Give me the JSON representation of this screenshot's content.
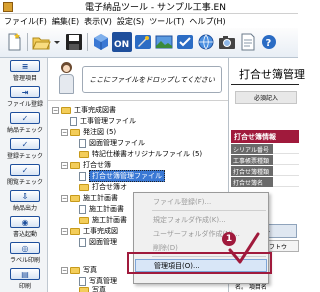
{
  "window": {
    "title": "電子納品ツール - サンプル工事.EN"
  },
  "menu": [
    "ファイル(F)",
    "編集(E)",
    "表示(V)",
    "設定(S)",
    "ツール(T)",
    "ヘルプ(H)"
  ],
  "colors": {
    "accent": "#a01a3c",
    "selection": "#3a78d4",
    "folder": "#f3cd5a",
    "toolbar_blue": "#1e4f9c"
  },
  "left_toolbar": [
    {
      "label": "管理項目",
      "icon": "document-list-icon"
    },
    {
      "label": "ファイル登録",
      "icon": "file-register-icon"
    },
    {
      "label": "納品チェック",
      "icon": "check-icon"
    },
    {
      "label": "登録チェック",
      "icon": "register-check-icon"
    },
    {
      "label": "閲覧チェック",
      "icon": "view-check-icon"
    },
    {
      "label": "納品出力",
      "icon": "output-icon"
    },
    {
      "label": "書込起動",
      "icon": "write-icon"
    },
    {
      "label": "ラベル印刷",
      "icon": "label-print-icon"
    },
    {
      "label": "印刷",
      "icon": "print-icon"
    }
  ],
  "drop_area": {
    "text": "ここにファイルをドロップしてください"
  },
  "tree": [
    {
      "label": "工事完成図書",
      "level": 0,
      "type": "folder"
    },
    {
      "label": "工事管理ファイル",
      "level": 1,
      "type": "file"
    },
    {
      "label": "発注図 (5)",
      "level": 1,
      "type": "folder"
    },
    {
      "label": "図面管理ファイル",
      "level": 2,
      "type": "file"
    },
    {
      "label": "特記仕様書オリジナルファイル (5)",
      "level": 2,
      "type": "folder"
    },
    {
      "label": "打合せ簿",
      "level": 1,
      "type": "folder"
    },
    {
      "label": "打合せ簿管理ファイル",
      "level": 2,
      "type": "file",
      "selected": true
    },
    {
      "label": "打合せ簿オ",
      "level": 2,
      "type": "folder"
    },
    {
      "label": "施工計画書",
      "level": 1,
      "type": "folder"
    },
    {
      "label": "施工計画書",
      "level": 2,
      "type": "file"
    },
    {
      "label": "施工計画書",
      "level": 2,
      "type": "folder"
    },
    {
      "label": "工事完成図",
      "level": 1,
      "type": "folder"
    },
    {
      "label": "図面管理",
      "level": 2,
      "type": "file"
    },
    {
      "label": "写真",
      "level": 1,
      "type": "folder"
    },
    {
      "label": "写真管理",
      "level": 2,
      "type": "file"
    },
    {
      "label": "写真",
      "level": 2,
      "type": "folder"
    }
  ],
  "context_menu": [
    {
      "label": "ファイル登録(F)...",
      "disabled": true
    },
    {
      "label": "---"
    },
    {
      "label": "規定フォルダ作成(K)...",
      "disabled": true
    },
    {
      "label": "ユーザーフォルダ作成(N)...",
      "disabled": true
    },
    {
      "label": "削除(D)",
      "disabled": true
    },
    {
      "label": "---"
    },
    {
      "label": "管理項目(O)...",
      "disabled": false,
      "highlighted": true
    }
  ],
  "callout": {
    "step": "1"
  },
  "right_panel": {
    "title": "打合せ簿管理",
    "required_label": "必須記入",
    "section_header": "打合せ簿情報",
    "rows": [
      "シリアル番号",
      "工事帳票種類",
      "打合せ簿種類",
      "打合せ簿名"
    ],
    "tab": "ファイル",
    "soft_label": "ソフトウ",
    "bottom_text": "名。    項目名"
  }
}
